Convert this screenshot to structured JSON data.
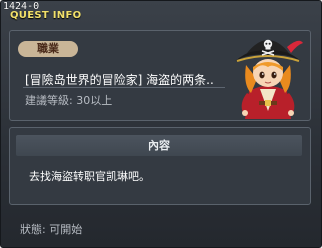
{
  "window": {
    "quest_id": "1424-0",
    "title": "QUEST INFO"
  },
  "quest": {
    "job_badge": "職業",
    "name": "[冒險岛世界的冒险家] 海盗的两条..",
    "level_requirement": "建議等級: 30以上",
    "npc_icon": "pirate-npc-portrait"
  },
  "content": {
    "header": "內容",
    "text": "去找海盜转职官凯琳吧。"
  },
  "status": {
    "text": "狀態:  可開始"
  }
}
